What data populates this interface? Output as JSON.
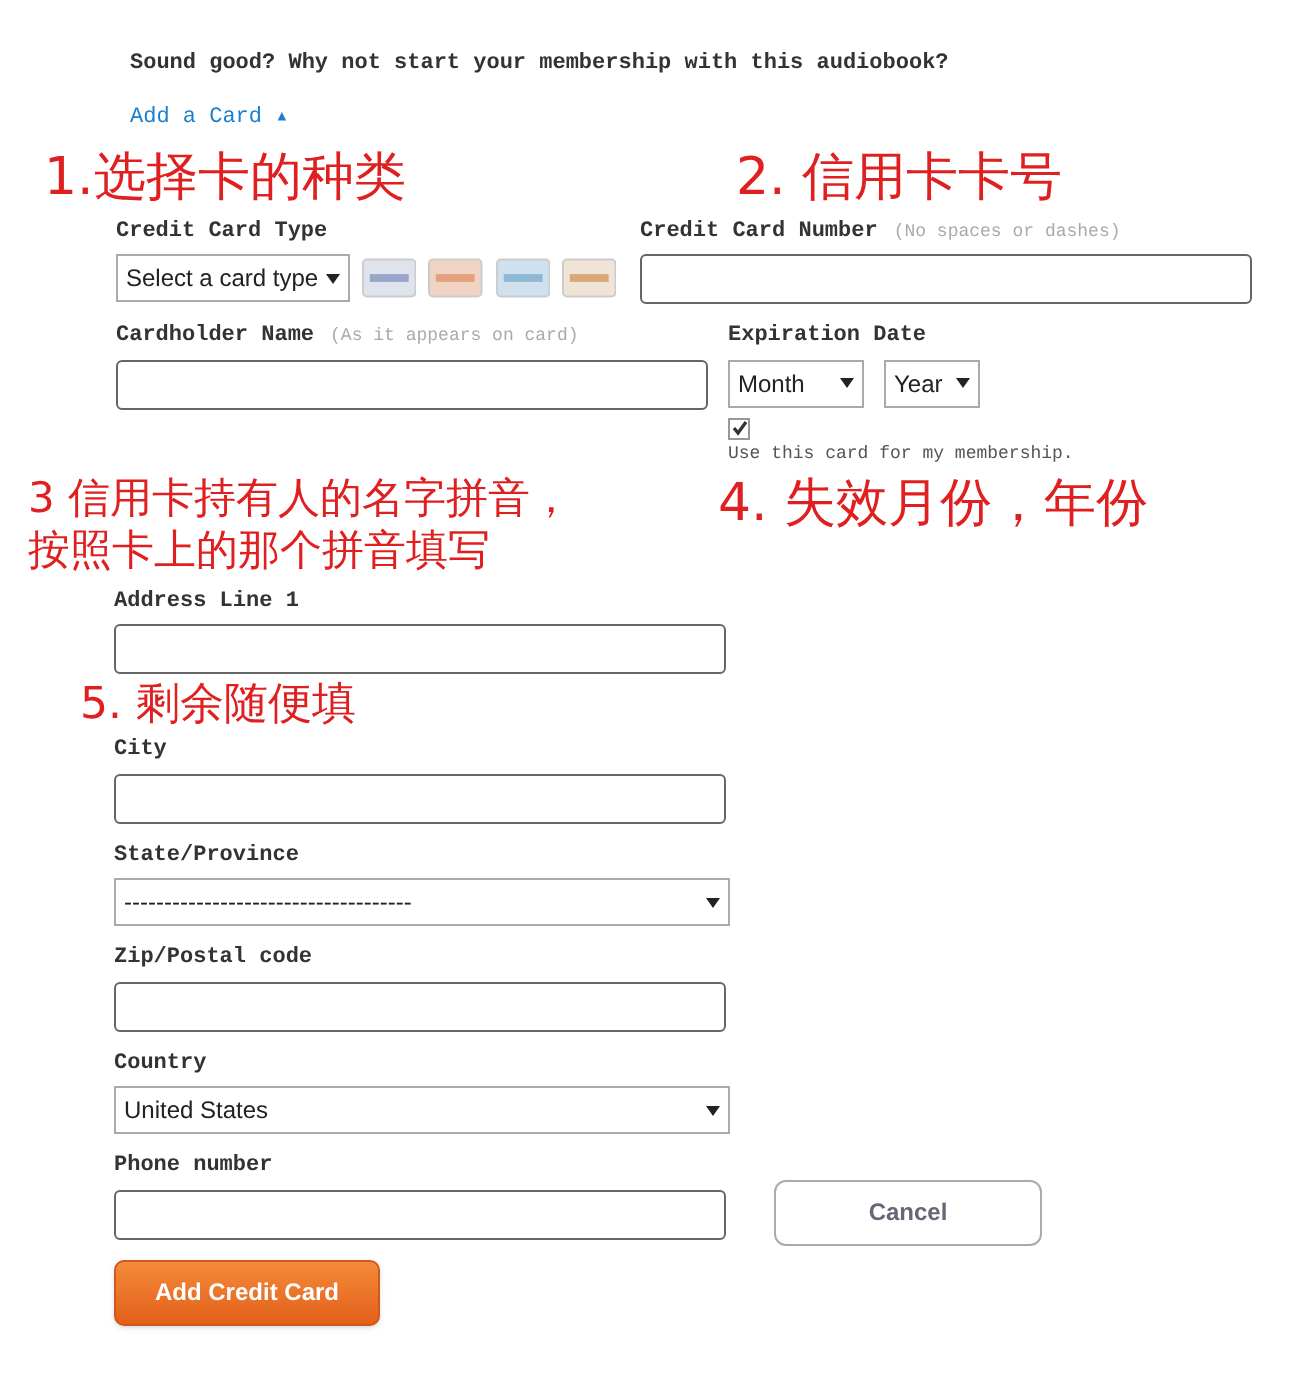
{
  "intro": "Sound good? Why not start your membership with this audiobook?",
  "add_card_link": "Add a Card ▴",
  "annotations": [
    "1.选择卡的种类",
    "2. 信用卡卡号",
    [
      "3 信用卡持有人的名字拼音，",
      "按照卡上的那个拼音填写"
    ],
    "4. 失效月份，年份",
    "5. 剩余随便填"
  ],
  "card_type": {
    "label": "Credit Card Type",
    "value": "Select a card type"
  },
  "card_number": {
    "label": "Credit Card Number",
    "hint": "(No spaces or dashes)"
  },
  "cardholder": {
    "label": "Cardholder Name",
    "hint": "(As it appears on card)"
  },
  "expiration": {
    "label": "Expiration Date",
    "month": "Month",
    "year": "Year"
  },
  "use_card": {
    "label": "Use this card for my membership.",
    "checked": true
  },
  "address_fields": [
    {
      "kind": "text",
      "label": "Address Line 1"
    },
    {
      "kind": "text",
      "label": "City"
    },
    {
      "kind": "select",
      "label": "State/Province",
      "value": "------------------------------------"
    },
    {
      "kind": "text",
      "label": "Zip/Postal code"
    },
    {
      "kind": "select",
      "label": "Country",
      "value": "United States"
    },
    {
      "kind": "text",
      "label": "Phone number"
    }
  ],
  "buttons": {
    "cancel": "Cancel",
    "submit": "Add Credit Card"
  }
}
